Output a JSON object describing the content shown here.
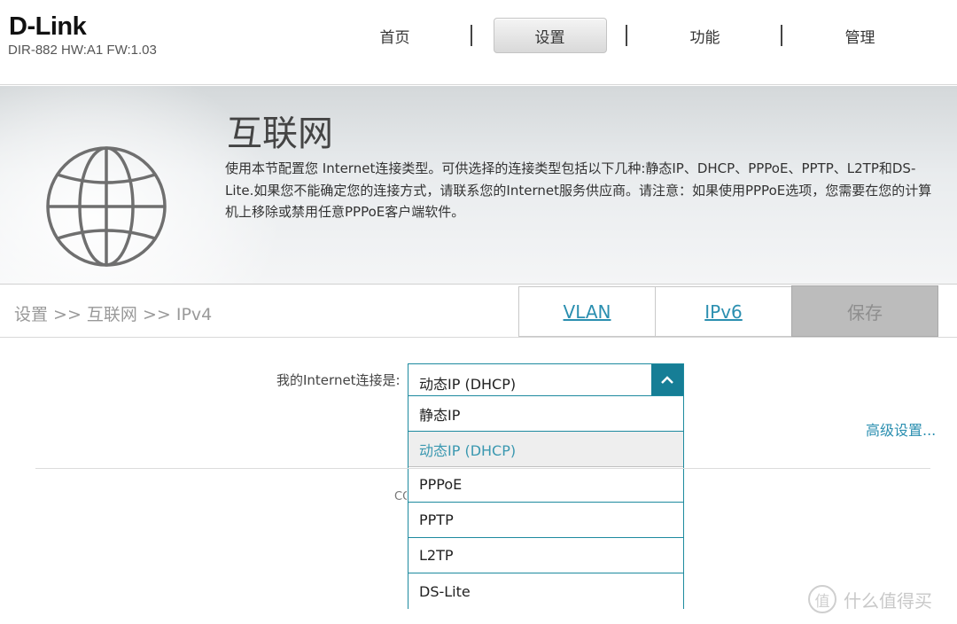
{
  "brand": {
    "logo": "D-Link",
    "model_info": "DIR-882 HW:A1 FW:1.03"
  },
  "nav": {
    "items": [
      {
        "label": "首页"
      },
      {
        "label": "设置",
        "active": true
      },
      {
        "label": "功能"
      },
      {
        "label": "管理"
      }
    ]
  },
  "banner": {
    "title": "互联网",
    "description": "使用本节配置您 Internet连接类型。可供选择的连接类型包括以下几种:静态IP、DHCP、PPPoE、PPTP、L2TP和DS-Lite.如果您不能确定您的连接方式，请联系您的Internet服务供应商。请注意：如果使用PPPoE选项，您需要在您的计算机上移除或禁用任意PPPoE客户端软件。",
    "icon": "globe-icon"
  },
  "breadcrumb": "设置 >> 互联网 >> IPv4",
  "tabs": {
    "vlan": "VLAN",
    "ipv6": "IPv6",
    "save": "保存"
  },
  "form": {
    "connection_label": "我的Internet连接是:",
    "connection_value": "动态IP (DHCP)",
    "options": [
      {
        "label": "静态IP"
      },
      {
        "label": "动态IP (DHCP)",
        "selected": true
      },
      {
        "label": "PPPoE"
      },
      {
        "label": "PPTP"
      },
      {
        "label": "L2TP"
      },
      {
        "label": "DS-Lite"
      }
    ],
    "advanced_link": "高级设置..."
  },
  "partial_text": "CO",
  "watermark": {
    "badge": "值",
    "text": "什么值得买"
  },
  "colors": {
    "accent": "#167e96",
    "link": "#2b8fb0",
    "save_bg": "#bcbcbc"
  }
}
